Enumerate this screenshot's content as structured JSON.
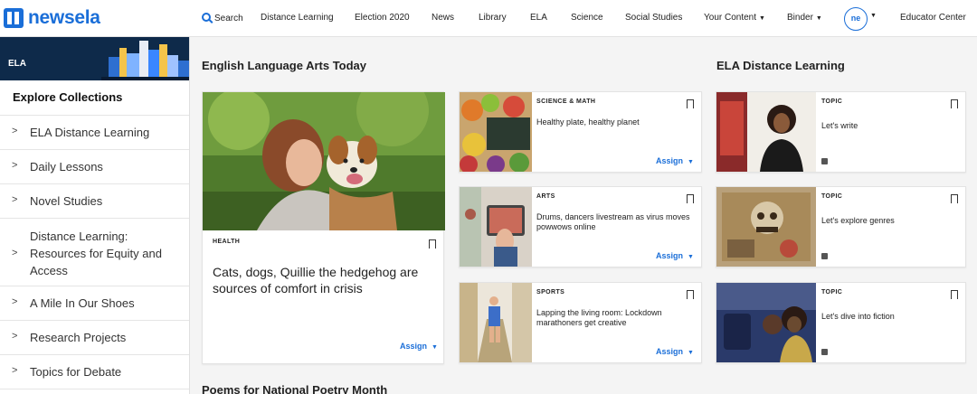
{
  "brand": {
    "name": "newsela"
  },
  "nav": {
    "search": "Search",
    "items": [
      "Distance Learning",
      "Election 2020",
      "News",
      "Library",
      "ELA",
      "Science",
      "Social Studies",
      "Your Content",
      "Binder",
      "Educator Center"
    ],
    "avatar": "ne"
  },
  "sidebar": {
    "banner_label": "ELA",
    "explore": "Explore Collections",
    "items": [
      "ELA Distance Learning",
      "Daily Lessons",
      "Novel Studies",
      "Distance Learning: Resources for Equity and Access",
      "A Mile In Our Shoes",
      "Research Projects",
      "Topics for Debate"
    ]
  },
  "sections": {
    "today": "English Language Arts Today",
    "distance": "ELA Distance Learning",
    "poems": "Poems for National Poetry Month"
  },
  "feature": {
    "category": "HEALTH",
    "headline": "Cats, dogs, Quillie the hedgehog are sources of comfort in crisis",
    "assign": "Assign"
  },
  "cards": [
    {
      "category": "SCIENCE & MATH",
      "headline": "Healthy plate, healthy planet",
      "assign": "Assign"
    },
    {
      "category": "ARTS",
      "headline": "Drums, dancers livestream as virus moves powwows online",
      "assign": "Assign"
    },
    {
      "category": "SPORTS",
      "headline": "Lapping the living room: Lockdown marathoners get creative",
      "assign": "Assign"
    }
  ],
  "topics": [
    {
      "category": "TOPIC",
      "headline": "Let's write"
    },
    {
      "category": "TOPIC",
      "headline": "Let's explore genres"
    },
    {
      "category": "TOPIC",
      "headline": "Let's dive into fiction"
    }
  ],
  "colors": {
    "brand": "#1a6ed8",
    "banner": "#0e2a4a"
  }
}
